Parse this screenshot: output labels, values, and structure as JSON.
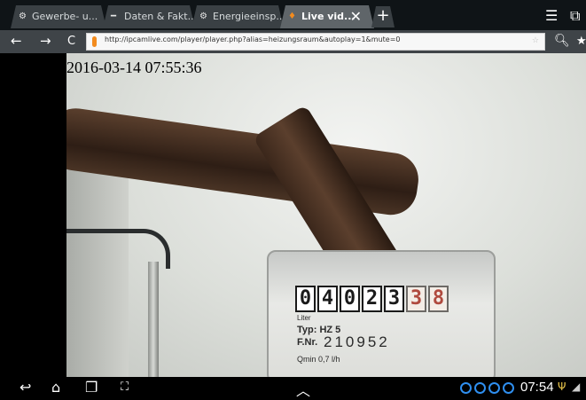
{
  "tabs": [
    {
      "label": "Gewerbe- u...",
      "icon": "globe-icon"
    },
    {
      "label": "Daten & Fakt...",
      "icon": "dash-icon"
    },
    {
      "label": "Energieeinsp...",
      "icon": "globe-icon"
    },
    {
      "label": "Live vid...",
      "icon": "flame-icon",
      "active": true
    }
  ],
  "new_tab_label": "+",
  "toolbar": {
    "url": "http://ipcamlive.com/player/player.php?alias=heizungsraum&autoplay=1&mute=0"
  },
  "video": {
    "timestamp": "2016-03-14 07:55:36",
    "meter_digits": [
      "0",
      "4",
      "0",
      "2",
      "3",
      "3",
      "8"
    ],
    "meter_red_from": 5,
    "meter_unit": "Liter",
    "meter_type": "Typ: HZ 5",
    "meter_number_prefix": "F.Nr.",
    "meter_number": "210952",
    "meter_qmin": "Qmin 0,7 l/h"
  },
  "status_bar": {
    "time": "07:54"
  },
  "colors": {
    "tab_bar": "#0f1417",
    "toolbar": "#3f4448",
    "sync_icon": "#2f8ff0"
  }
}
